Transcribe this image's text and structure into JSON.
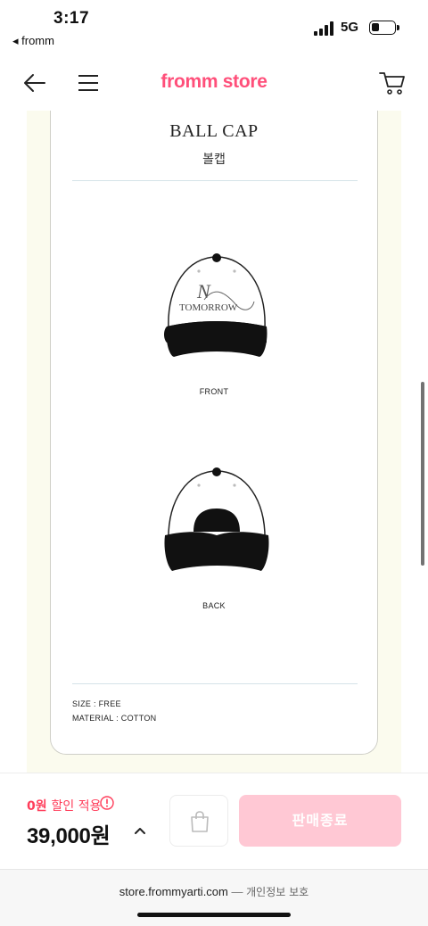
{
  "status_bar": {
    "time": "3:17",
    "back_app": "◂ fromm",
    "network": "5G"
  },
  "header": {
    "brand": "fromm store"
  },
  "product_card": {
    "title": "BALL CAP",
    "subtitle": "볼캡",
    "cap_logo_text": "TOMORROW",
    "front_label": "FRONT",
    "back_label": "BACK",
    "size": "SIZE : FREE",
    "material": "MATERIAL : COTTON"
  },
  "purchase": {
    "discount_amount": "0원",
    "discount_text": "할인 적용",
    "price": "39,000원",
    "soldout_label": "판매종료"
  },
  "browser": {
    "url": "store.frommyarti.com",
    "separator": "—",
    "privacy": "개인정보 보호"
  },
  "colors": {
    "brand": "#ff4f7a",
    "discount": "#ff3d5a",
    "soldout_bg": "#ffc8d4",
    "content_bg": "#fbfbee"
  }
}
